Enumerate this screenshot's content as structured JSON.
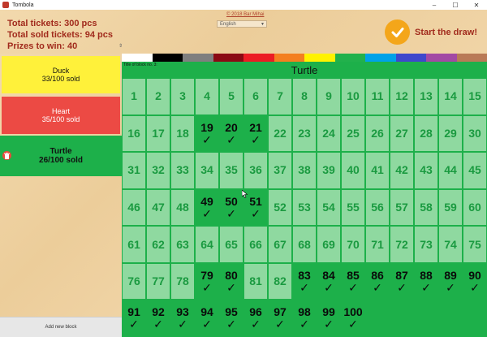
{
  "window": {
    "title": "Tombola",
    "minimize": "–",
    "maximize": "☐",
    "close": "✕"
  },
  "header": {
    "total_tickets": "Total tickets: 300 pcs",
    "total_sold": "Total sold tickets: 94 pcs",
    "prizes": "Prizes to win: 40",
    "copyright": "© 2018 Bar Mihai",
    "language": "English",
    "start_draw": "Start the draw!"
  },
  "colors": {
    "accent_red": "#a12a1c",
    "grid_green": "#1db04a",
    "unsold_cell": "#8fd9a0",
    "draw_button": "#f4a61a",
    "swatches": [
      "#ffffff",
      "#000000",
      "#7f7f7f",
      "#8b0a14",
      "#ec1c24",
      "#f47f20",
      "#fff200",
      "#22b14c",
      "#00a2e8",
      "#3f48cc",
      "#a349a4",
      "#b97a57"
    ]
  },
  "sidebar": {
    "blocks": [
      {
        "name": "Duck",
        "sold": "33/100 sold",
        "color": "#fff13a",
        "text_color": "#111111"
      },
      {
        "name": "Heart",
        "sold": "35/100 sold",
        "color": "#ec4a44",
        "text_color": "#ffffff"
      },
      {
        "name": "Turtle",
        "sold": "26/100 sold",
        "color": "#1db04a",
        "text_color": "#111111"
      }
    ],
    "add_block": "Add new block"
  },
  "main": {
    "block_label": "Title of block no. 3:",
    "block_title": "Turtle",
    "check_symbol": "✓",
    "columns": 15,
    "rows": 7,
    "total_numbers": 100,
    "sold": [
      19,
      20,
      21,
      49,
      50,
      51,
      79,
      80,
      83,
      84,
      85,
      86,
      87,
      88,
      89,
      90,
      91,
      92,
      93,
      94,
      95,
      96,
      97,
      98,
      99,
      100
    ]
  }
}
